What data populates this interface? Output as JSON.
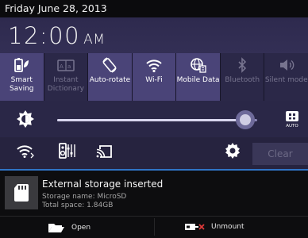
{
  "status": {
    "date": "Friday June 28, 2013"
  },
  "clock": {
    "time": "12:00",
    "ampm": "AM"
  },
  "quick_settings": [
    {
      "label": "Smart Saving",
      "icon": "battery-leaf-icon",
      "state": "on"
    },
    {
      "label": "Instant Dictionary",
      "icon": "dictionary-icon",
      "state": "off"
    },
    {
      "label": "Auto-rotate",
      "icon": "rotate-icon",
      "state": "on"
    },
    {
      "label": "Wi-Fi",
      "icon": "wifi-icon",
      "state": "on"
    },
    {
      "label": "Mobile Data",
      "icon": "globe-data-icon",
      "state": "on"
    },
    {
      "label": "Bluetooth",
      "icon": "bluetooth-icon",
      "state": "off"
    },
    {
      "label": "Silent mode",
      "icon": "speaker-icon",
      "state": "off"
    }
  ],
  "brightness": {
    "level": 0.94,
    "auto_label": "AUTO"
  },
  "toolbar": {
    "clear_label": "Clear"
  },
  "notification": {
    "title": "External storage inserted",
    "line1": "Storage name: MicroSD",
    "line2": "Total space: 1.84GB",
    "action_open": "Open",
    "action_unmount": "Unmount"
  },
  "colors": {
    "accent": "#2f74c7",
    "panel": "#2a2747",
    "active_tile": "#4a4478"
  }
}
